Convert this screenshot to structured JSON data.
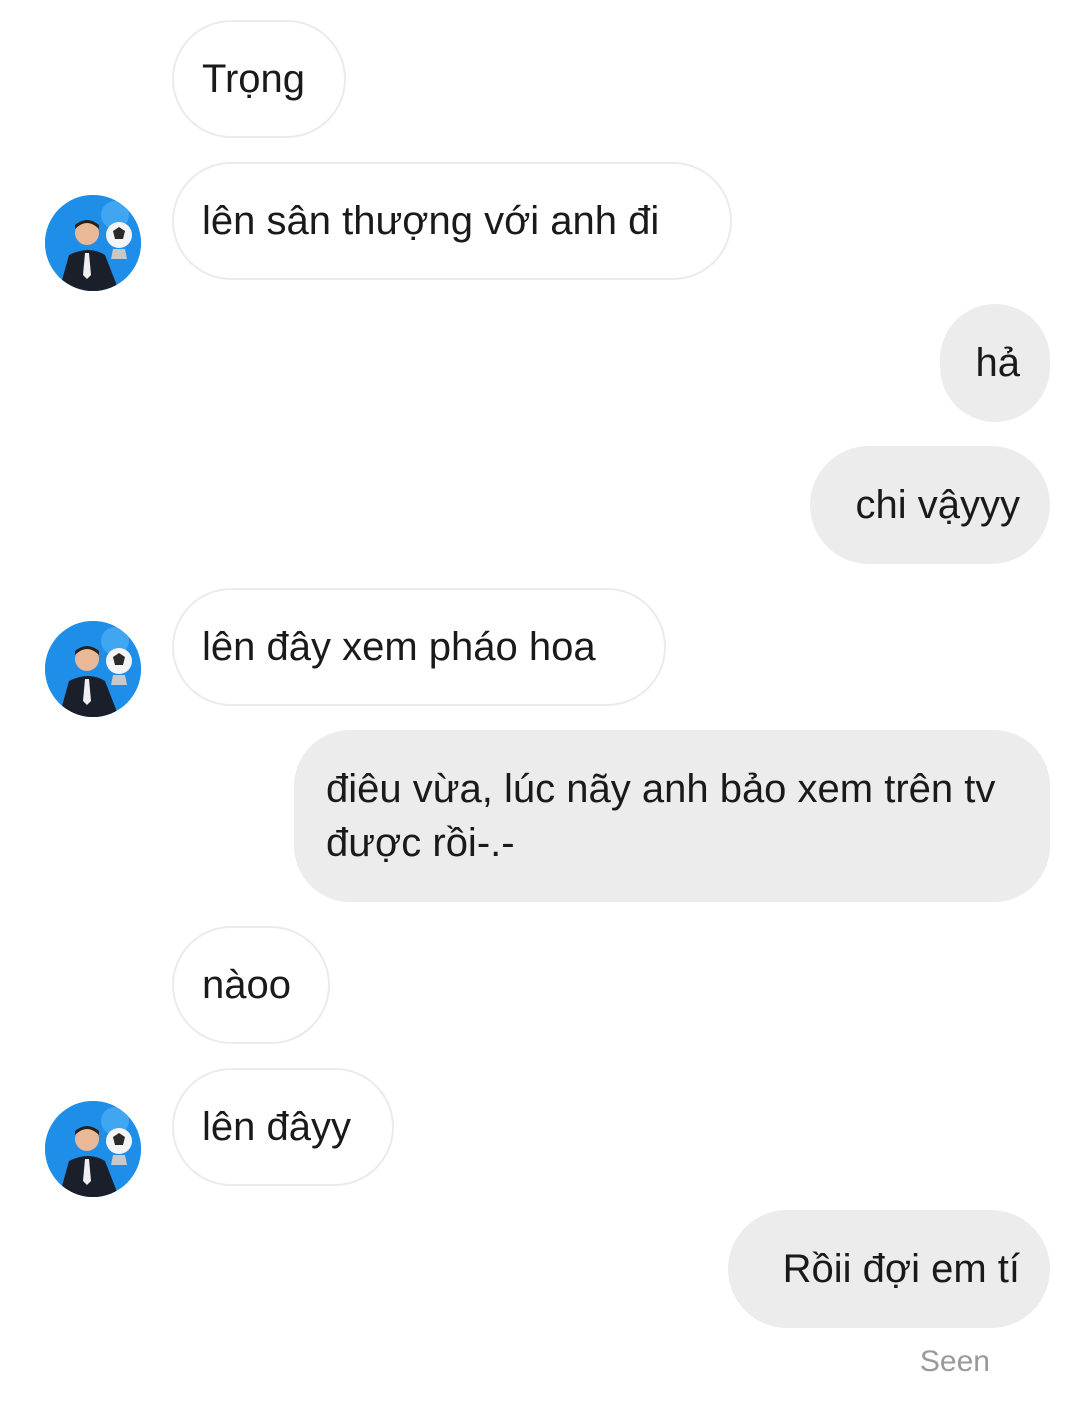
{
  "conversation": {
    "messages": [
      {
        "side": "in",
        "text": "Trọng"
      },
      {
        "side": "in",
        "text": "lên sân thượng với anh đi"
      },
      {
        "side": "out",
        "text": "hả"
      },
      {
        "side": "out",
        "text": "chi vậyyy"
      },
      {
        "side": "in",
        "text": "lên đây xem pháo hoa"
      },
      {
        "side": "out",
        "text": "điêu vừa, lúc nãy anh bảo xem trên tv được rồi-.-"
      },
      {
        "side": "in",
        "text": "nàoo"
      },
      {
        "side": "in",
        "text": "lên đâyy"
      },
      {
        "side": "out",
        "text": "Rồii đợi em tí"
      }
    ],
    "status": "Seen"
  },
  "colors": {
    "incoming_bubble": "#ffffff",
    "incoming_border": "#ebebeb",
    "outgoing_bubble": "#ececec",
    "avatar_bg": "#1e8ee8",
    "seen_text": "#9a9a9a"
  },
  "icons": {
    "avatar": "contact-avatar-icon"
  }
}
